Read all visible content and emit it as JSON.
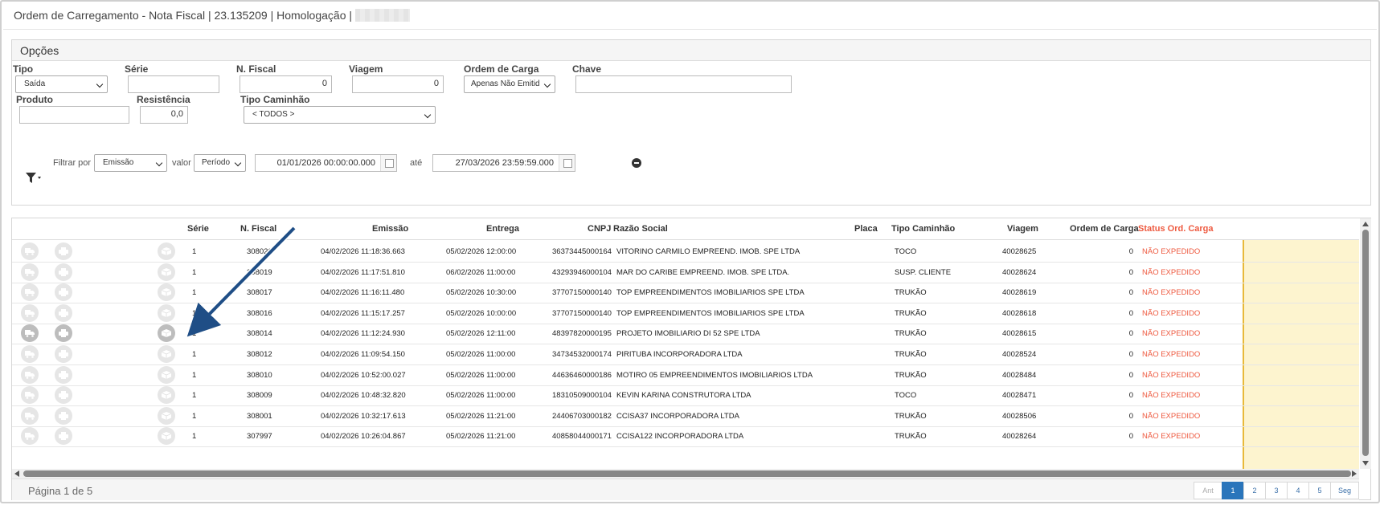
{
  "window": {
    "title": "Ordem de Carregamento - Nota Fiscal | 23.135209 | Homologação |"
  },
  "options": {
    "header": "Opções",
    "fields": {
      "tipo": {
        "label": "Tipo",
        "value": "Saída"
      },
      "serie": {
        "label": "Série",
        "value": ""
      },
      "nfiscal": {
        "label": "N. Fiscal",
        "value": "0"
      },
      "viagem": {
        "label": "Viagem",
        "value": "0"
      },
      "ordem": {
        "label": "Ordem de Carga",
        "value": "Apenas Não Emitid"
      },
      "chave": {
        "label": "Chave",
        "value": ""
      },
      "produto": {
        "label": "Produto",
        "value": ""
      },
      "resistencia": {
        "label": "Resistência",
        "value": "0,0"
      },
      "tipo_caminhao": {
        "label": "Tipo Caminhão",
        "value": "< TODOS >"
      }
    },
    "filter": {
      "by_label": "Filtrar por",
      "by_value": "Emissão",
      "valor_label": "valor",
      "valor_value": "Período",
      "from": "01/01/2026 00:00:00.000",
      "ate_label": "até",
      "to": "27/03/2026 23:59:59.000"
    }
  },
  "grid": {
    "columns": {
      "serie": "Série",
      "nfiscal": "N. Fiscal",
      "emissao": "Emissão",
      "entrega": "Entrega",
      "cnpj": "CNPJ",
      "razao": "Razão Social",
      "placa": "Placa",
      "tipo": "Tipo Caminhão",
      "viagem": "Viagem",
      "ordem": "Ordem de Carga",
      "status": "Status Ord. Carga"
    },
    "rows": [
      {
        "serie": "1",
        "nf": "308020",
        "emissao": "04/02/2026 11:18:36.663",
        "entrega": "05/02/2026 12:00:00",
        "cnpj": "36373445000164",
        "razao": "VITORINO CARMILO EMPREEND. IMOB. SPE LTDA",
        "placa": "",
        "tipo": "TOCO",
        "viagem": "40028625",
        "ordem": "0",
        "status": "NÃO EXPEDIDO"
      },
      {
        "serie": "1",
        "nf": "308019",
        "emissao": "04/02/2026 11:17:51.810",
        "entrega": "06/02/2026 11:00:00",
        "cnpj": "43293946000104",
        "razao": "MAR DO CARIBE EMPREEND. IMOB. SPE LTDA.",
        "placa": "",
        "tipo": "SUSP. CLIENTE",
        "viagem": "40028624",
        "ordem": "0",
        "status": "NÃO EXPEDIDO"
      },
      {
        "serie": "1",
        "nf": "308017",
        "emissao": "04/02/2026 11:16:11.480",
        "entrega": "05/02/2026 10:30:00",
        "cnpj": "37707150000140",
        "razao": "TOP EMPREENDIMENTOS IMOBILIARIOS SPE LTDA",
        "placa": "",
        "tipo": "TRUKÃO",
        "viagem": "40028619",
        "ordem": "0",
        "status": "NÃO EXPEDIDO"
      },
      {
        "serie": "1",
        "nf": "308016",
        "emissao": "04/02/2026 11:15:17.257",
        "entrega": "05/02/2026 10:00:00",
        "cnpj": "37707150000140",
        "razao": "TOP EMPREENDIMENTOS IMOBILIARIOS SPE LTDA",
        "placa": "",
        "tipo": "TRUKÃO",
        "viagem": "40028618",
        "ordem": "0",
        "status": "NÃO EXPEDIDO"
      },
      {
        "serie": "1",
        "nf": "308014",
        "emissao": "04/02/2026 11:12:24.930",
        "entrega": "05/02/2026 12:11:00",
        "cnpj": "48397820000195",
        "razao": "PROJETO IMOBILIARIO DI 52 SPE LTDA",
        "placa": "",
        "tipo": "TRUKÃO",
        "viagem": "40028615",
        "ordem": "0",
        "status": "NÃO EXPEDIDO"
      },
      {
        "serie": "1",
        "nf": "308012",
        "emissao": "04/02/2026 11:09:54.150",
        "entrega": "05/02/2026 11:00:00",
        "cnpj": "34734532000174",
        "razao": "PIRITUBA INCORPORADORA LTDA",
        "placa": "",
        "tipo": "TRUKÃO",
        "viagem": "40028524",
        "ordem": "0",
        "status": "NÃO EXPEDIDO"
      },
      {
        "serie": "1",
        "nf": "308010",
        "emissao": "04/02/2026 10:52:00.027",
        "entrega": "05/02/2026 11:00:00",
        "cnpj": "44636460000186",
        "razao": "MOTIRO 05 EMPREENDIMENTOS IMOBILIARIOS LTDA",
        "placa": "",
        "tipo": "TRUKÃO",
        "viagem": "40028484",
        "ordem": "0",
        "status": "NÃO EXPEDIDO"
      },
      {
        "serie": "1",
        "nf": "308009",
        "emissao": "04/02/2026 10:48:32.820",
        "entrega": "05/02/2026 11:00:00",
        "cnpj": "18310509000104",
        "razao": "KEVIN KARINA CONSTRUTORA LTDA",
        "placa": "",
        "tipo": "TOCO",
        "viagem": "40028471",
        "ordem": "0",
        "status": "NÃO EXPEDIDO"
      },
      {
        "serie": "1",
        "nf": "308001",
        "emissao": "04/02/2026 10:32:17.613",
        "entrega": "05/02/2026 11:21:00",
        "cnpj": "24406703000182",
        "razao": "CCISA37 INCORPORADORA LTDA",
        "placa": "",
        "tipo": "TRUKÃO",
        "viagem": "40028506",
        "ordem": "0",
        "status": "NÃO EXPEDIDO"
      },
      {
        "serie": "1",
        "nf": "307997",
        "emissao": "04/02/2026 10:26:04.867",
        "entrega": "05/02/2026 11:21:00",
        "cnpj": "40858044000171",
        "razao": "CCISA122 INCORPORADORA LTDA",
        "placa": "",
        "tipo": "TRUKÃO",
        "viagem": "40028264",
        "ordem": "0",
        "status": "NÃO EXPEDIDO"
      }
    ]
  },
  "footer": {
    "page_info": "Página 1 de 5",
    "pager": {
      "prev": "Ant",
      "pages": [
        "1",
        "2",
        "3",
        "4",
        "5"
      ],
      "next": "Seg",
      "active": "1"
    }
  },
  "icons": {
    "truck": "truck-icon",
    "print": "printer-icon",
    "box": "box-icon",
    "filter": "filter-icon",
    "remove": "minus-circle-icon"
  },
  "colors": {
    "accent": "#2a75bb",
    "status_text": "#ee5a40",
    "status_bg": "#fdf4cf",
    "annotation_arrow": "#1f4e86"
  }
}
